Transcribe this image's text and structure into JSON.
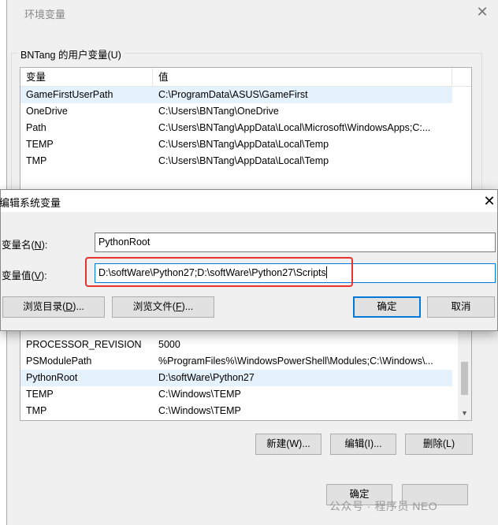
{
  "env_dialog": {
    "title": "环境变量",
    "close_glyph": "✕",
    "user_group_label": "BNTang 的用户变量(U)",
    "user_columns": [
      "变量",
      "值"
    ],
    "user_vars": [
      {
        "name": "GameFirstUserPath",
        "value": "C:\\ProgramData\\ASUS\\GameFirst"
      },
      {
        "name": "OneDrive",
        "value": "C:\\Users\\BNTang\\OneDrive"
      },
      {
        "name": "Path",
        "value": "C:\\Users\\BNTang\\AppData\\Local\\Microsoft\\WindowsApps;C:..."
      },
      {
        "name": "TEMP",
        "value": "C:\\Users\\BNTang\\AppData\\Local\\Temp"
      },
      {
        "name": "TMP",
        "value": "C:\\Users\\BNTang\\AppData\\Local\\Temp"
      }
    ],
    "system_vars": [
      {
        "name": "PROCESSOR_REVISION",
        "value": "5000"
      },
      {
        "name": "PSModulePath",
        "value": "%ProgramFiles%\\WindowsPowerShell\\Modules;C:\\Windows\\..."
      },
      {
        "name": "PythonRoot",
        "value": "D:\\softWare\\Python27"
      },
      {
        "name": "TEMP",
        "value": "C:\\Windows\\TEMP"
      },
      {
        "name": "TMP",
        "value": "C:\\Windows\\TEMP"
      }
    ],
    "new_button": "新建(W)...",
    "edit_button": "编辑(I)...",
    "delete_button": "删除(L)",
    "ok_button": "确定"
  },
  "edit_dialog": {
    "title": "编辑系统变量",
    "close_glyph": "✕",
    "name_label_prefix": "变量名(",
    "name_label_key": "N",
    "name_label_suffix": "):",
    "name_value": "PythonRoot",
    "value_label_prefix": "变量值(",
    "value_label_key": "V",
    "value_label_suffix": "):",
    "value_value": "D:\\softWare\\Python27;D:\\softWare\\Python27\\Scripts",
    "browse_dir_prefix": "浏览目录(",
    "browse_dir_key": "D",
    "browse_dir_suffix": ")...",
    "browse_file_prefix": "浏览文件(",
    "browse_file_key": "F",
    "browse_file_suffix": ")...",
    "ok_button": "确定",
    "cancel_button": "取消"
  },
  "watermark": "公众号 · 程序员 NEO",
  "colors": {
    "selection": "#e5f1fb",
    "focus_border": "#0078d7",
    "highlight_box": "#e8332d"
  }
}
